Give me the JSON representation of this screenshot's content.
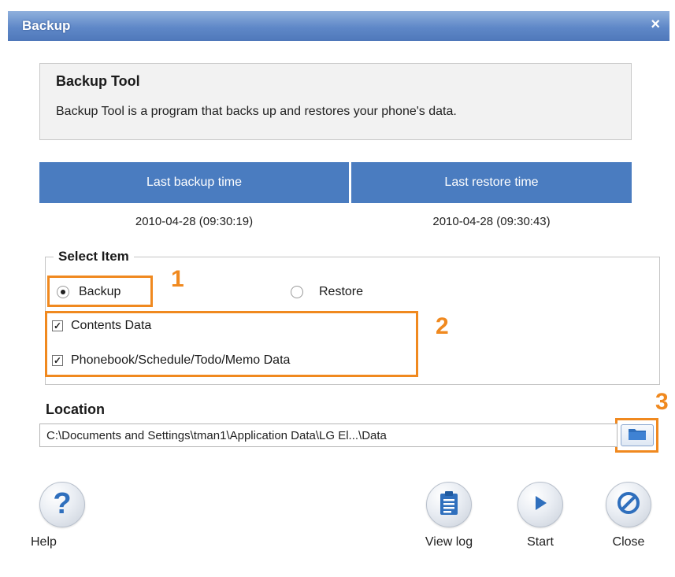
{
  "window": {
    "title": "Backup",
    "close_glyph": "×"
  },
  "info": {
    "title": "Backup Tool",
    "description": "Backup Tool is a program that backs up and restores your phone's data."
  },
  "times": {
    "backup_header": "Last backup time",
    "restore_header": "Last restore time",
    "backup_value": "2010-04-28 (09:30:19)",
    "restore_value": "2010-04-28 (09:30:43)"
  },
  "select_item": {
    "legend": "Select Item",
    "backup_label": "Backup",
    "restore_label": "Restore",
    "selected": "Backup",
    "contents_label": "Contents Data",
    "contents_checked": true,
    "phonebook_label": "Phonebook/Schedule/Todo/Memo Data",
    "phonebook_checked": true
  },
  "annotations": {
    "n1": "1",
    "n2": "2",
    "n3": "3"
  },
  "location": {
    "label": "Location",
    "value": "C:\\Documents and Settings\\tman1\\Application Data\\LG El...\\Data"
  },
  "buttons": {
    "help": "Help",
    "view_log": "View log",
    "start": "Start",
    "close": "Close"
  },
  "colors": {
    "titlebar": "#5f88c8",
    "header_blue": "#4a7cc0",
    "highlight_orange": "#f0891f",
    "icon_blue": "#2f6fbd"
  },
  "icons": {
    "help": "question-icon",
    "view_log": "clipboard-icon",
    "start": "play-icon",
    "close": "no-entry-icon",
    "browse": "folder-icon"
  }
}
